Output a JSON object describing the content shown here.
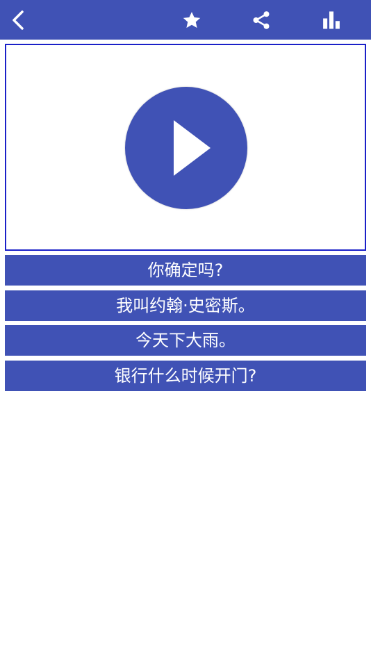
{
  "colors": {
    "primary": "#4052b5",
    "video_border": "#1a20c8",
    "background": "#ffffff",
    "text_on_primary": "#ffffff"
  },
  "toolbar": {
    "back_icon": "chevron-left-icon",
    "favorite_icon": "star-icon",
    "share_icon": "share-icon",
    "stats_icon": "bar-chart-icon"
  },
  "player": {
    "play_icon": "play-icon"
  },
  "phrases": [
    {
      "text": "你确定吗?"
    },
    {
      "text": "我叫约翰·史密斯。"
    },
    {
      "text": "今天下大雨。"
    },
    {
      "text": "银行什么时候开门?"
    }
  ]
}
